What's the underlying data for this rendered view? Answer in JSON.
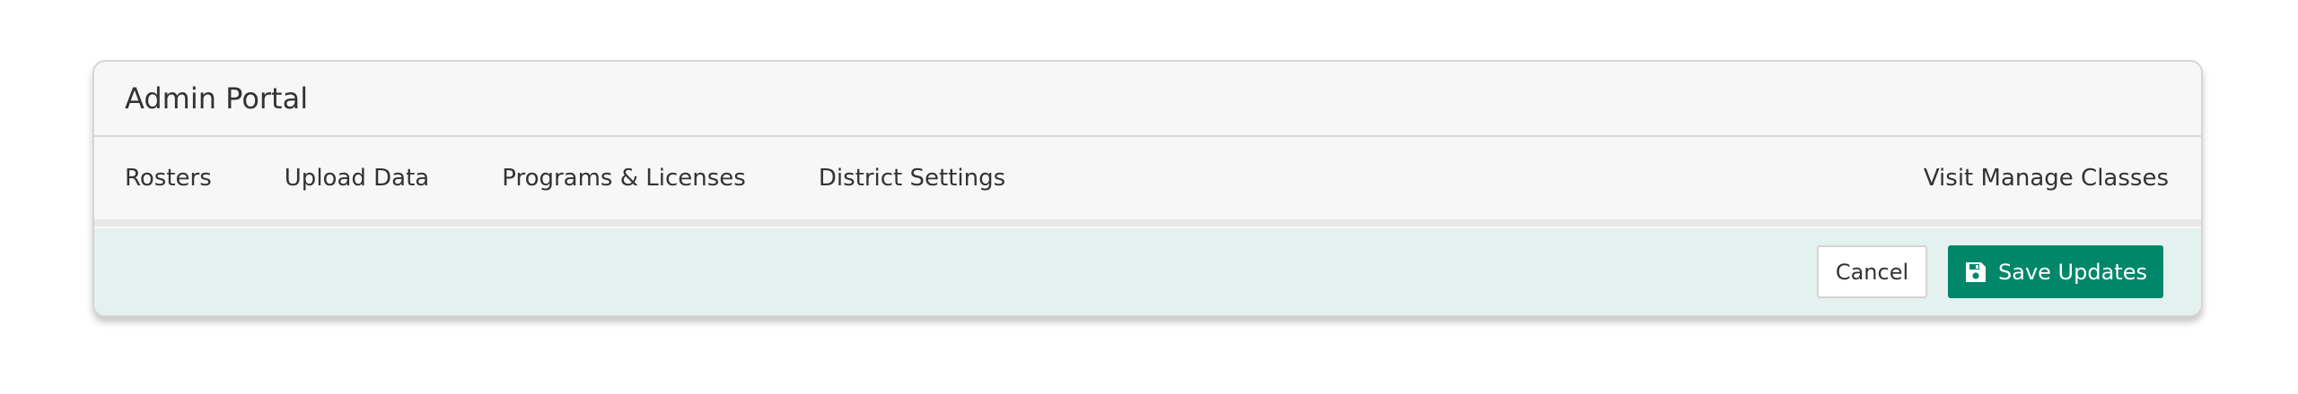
{
  "header": {
    "title": "Admin Portal"
  },
  "nav": {
    "items": [
      {
        "label": "Rosters"
      },
      {
        "label": "Upload Data"
      },
      {
        "label": "Programs & Licenses"
      },
      {
        "label": "District Settings"
      }
    ],
    "right_link": "Visit Manage Classes"
  },
  "actions": {
    "cancel_label": "Cancel",
    "save_label": "Save Updates",
    "save_icon": "floppy-disk-icon"
  },
  "colors": {
    "accent": "#00876a",
    "action_bar_bg": "#e3f2ef",
    "panel_bg": "#f7f7f7",
    "text": "#333333"
  }
}
